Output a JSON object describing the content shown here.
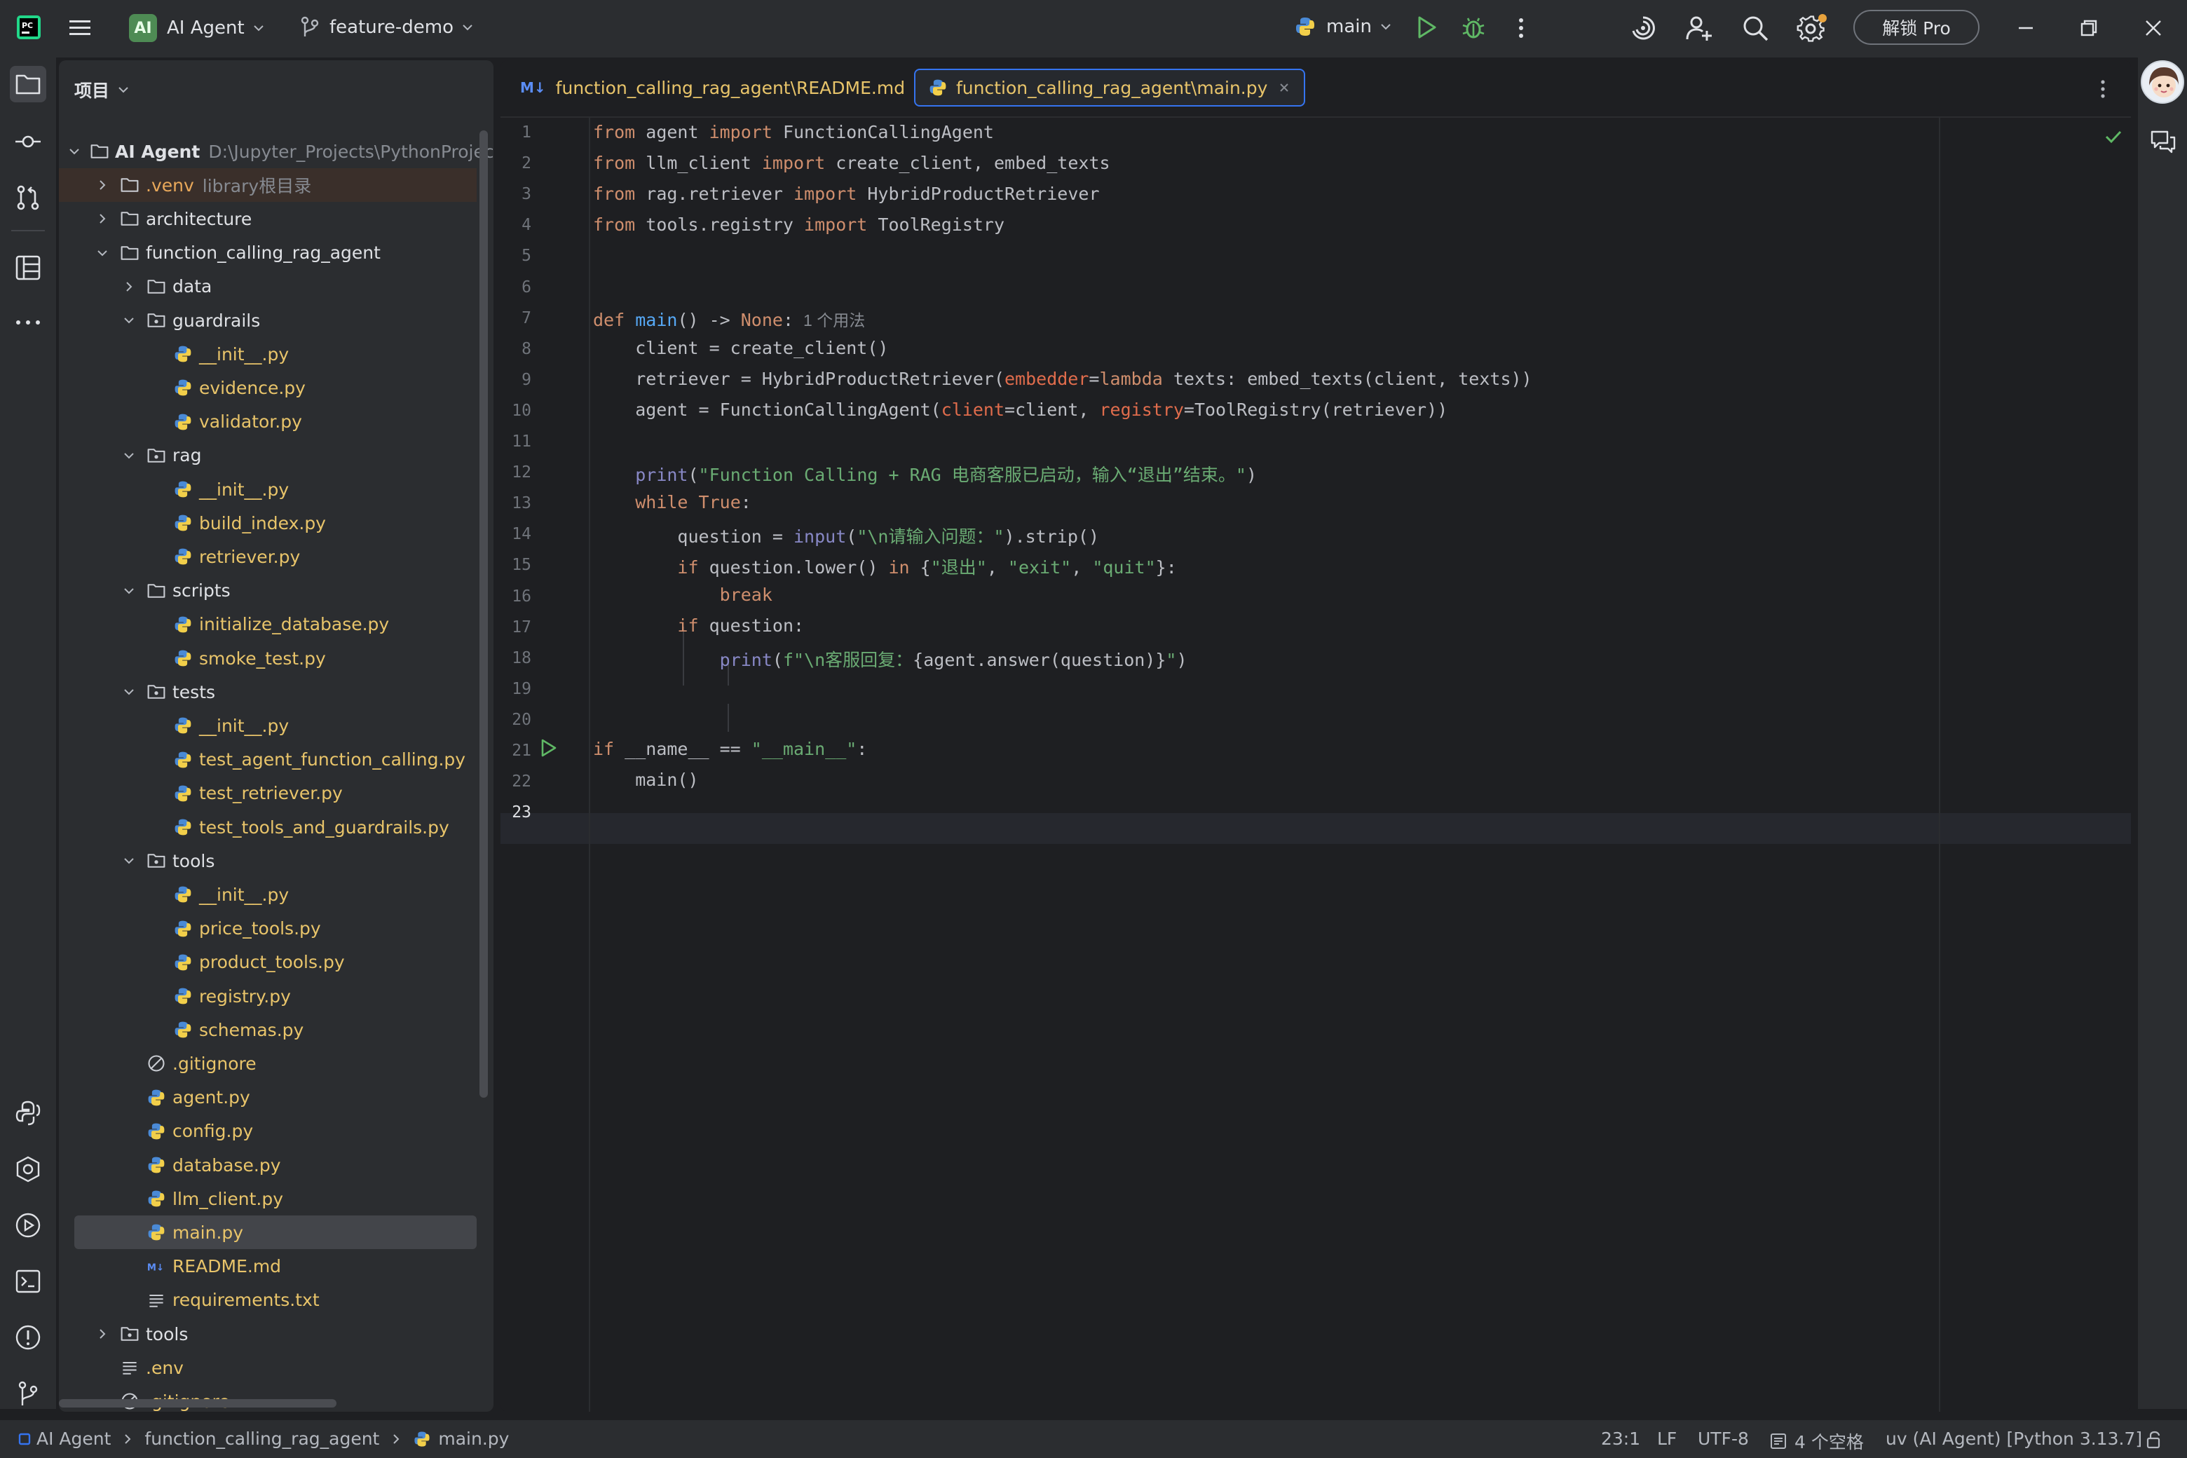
{
  "titlebar": {
    "project_badge": "AI",
    "project_name": "AI Agent",
    "branch": "feature-demo",
    "run_config": "main",
    "pro_button": "解锁 Pro"
  },
  "project_panel": {
    "title": "项目",
    "root_name": "AI Agent",
    "root_path": "D:\\Jupyter_Projects\\PythonProject",
    "venv_name": ".venv",
    "venv_note": "library根目录",
    "items": [
      "architecture",
      "function_calling_rag_agent",
      "data",
      "guardrails",
      "__init__.py",
      "evidence.py",
      "validator.py",
      "rag",
      "__init__.py",
      "build_index.py",
      "retriever.py",
      "scripts",
      "initialize_database.py",
      "smoke_test.py",
      "tests",
      "__init__.py",
      "test_agent_function_calling.py",
      "test_retriever.py",
      "test_tools_and_guardrails.py",
      "tools",
      "__init__.py",
      "price_tools.py",
      "product_tools.py",
      "registry.py",
      "schemas.py",
      ".gitignore",
      "agent.py",
      "config.py",
      "database.py",
      "llm_client.py",
      "main.py",
      "README.md",
      "requirements.txt",
      "tools",
      ".env",
      ".gitignore"
    ]
  },
  "editor": {
    "tabs": [
      {
        "label": "function_calling_rag_agent\\README.md",
        "icon": "markdown-icon",
        "badge": "M↓"
      },
      {
        "label": "function_calling_rag_agent\\main.py",
        "icon": "python-file-icon"
      }
    ],
    "line_numbers": [
      "1",
      "2",
      "3",
      "4",
      "5",
      "6",
      "7",
      "8",
      "9",
      "10",
      "11",
      "12",
      "13",
      "14",
      "15",
      "16",
      "17",
      "18",
      "19",
      "20",
      "21",
      "22",
      "23"
    ],
    "usage_hint": "1 个用法",
    "code": {
      "l1": [
        "from",
        " agent ",
        "import",
        " FunctionCallingAgent"
      ],
      "l2": [
        "from",
        " llm_client ",
        "import",
        " create_client, embed_texts"
      ],
      "l3": [
        "from",
        " rag.retriever ",
        "import",
        " HybridProductRetriever"
      ],
      "l4": [
        "from",
        " tools.registry ",
        "import",
        " ToolRegistry"
      ],
      "l7": [
        "def",
        " ",
        "main",
        "() -> ",
        "None",
        ":"
      ],
      "l8": "    client = create_client()",
      "l9": [
        "    retriever = HybridProductRetriever(",
        "embedder",
        "=",
        "lambda",
        " texts: embed_texts(client, texts))"
      ],
      "l10": [
        "    agent = FunctionCallingAgent(",
        "client",
        "=client, ",
        "registry",
        "=ToolRegistry(retriever))"
      ],
      "l12": [
        "    ",
        "print",
        "(",
        "\"Function Calling + RAG 电商客服已启动，输入“退出”结束。\"",
        ")"
      ],
      "l13": [
        "    ",
        "while",
        " ",
        "True",
        ":"
      ],
      "l14": [
        "        question = ",
        "input",
        "(",
        "\"\\n请输入问题：\"",
        ").strip()"
      ],
      "l15": [
        "        ",
        "if",
        " question.lower() ",
        "in",
        " {",
        "\"退出\"",
        ", ",
        "\"exit\"",
        ", ",
        "\"quit\"",
        "}:"
      ],
      "l16": [
        "            ",
        "break"
      ],
      "l17": [
        "        ",
        "if",
        " question:"
      ],
      "l18": [
        "            ",
        "print",
        "(",
        "f\"\\n客服回复：",
        "{agent.answer(question)}",
        "\"",
        ")"
      ],
      "l21": [
        "if",
        " __name__ == ",
        "\"__main__\"",
        ":"
      ],
      "l22": "    main()"
    }
  },
  "statusbar": {
    "breadcrumbs": [
      "AI Agent",
      "function_calling_rag_agent",
      "main.py"
    ],
    "position": "23:1",
    "line_separator": "LF",
    "encoding": "UTF-8",
    "indent": "4 个空格",
    "interpreter": "uv (AI Agent) [Python 3.13.7]"
  },
  "colors": {
    "background": "#1e1f22",
    "panel": "#2b2d30",
    "keyword": "#cf8e6d",
    "function": "#56a8f5",
    "string": "#6aab73",
    "param": "#e06c4c",
    "accent": "#3574f0"
  }
}
